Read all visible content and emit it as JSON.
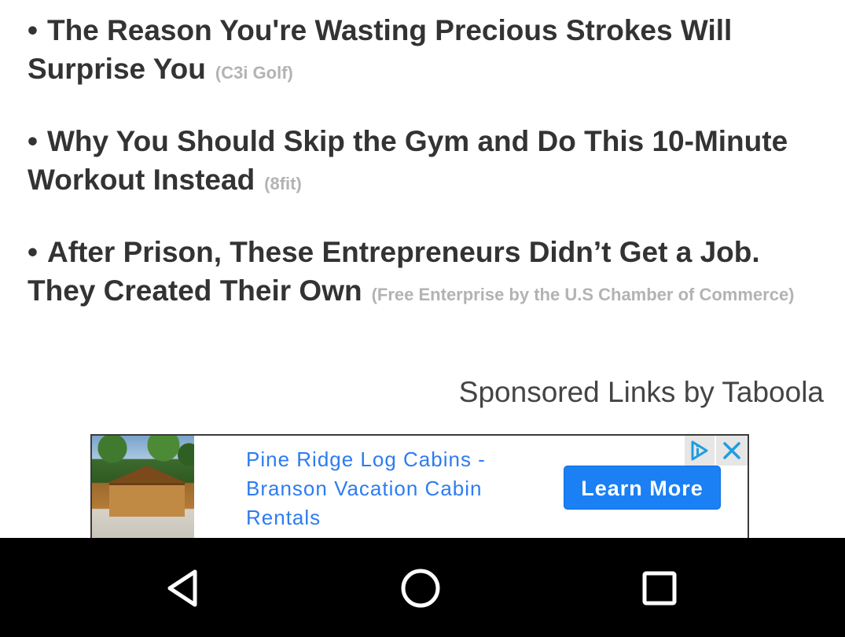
{
  "links": [
    {
      "bullet": "•",
      "title": "The Reason You're Wasting Precious Strokes Will Surprise You",
      "source": "(C3i Golf)"
    },
    {
      "bullet": "•",
      "title": "Why You Should Skip the Gym and Do This 10-Minute Workout Instead",
      "source": "(8fit)"
    },
    {
      "bullet": "•",
      "title": "After Prison, These Entrepreneurs Didn’t Get a Job. They Created Their Own",
      "source": "(Free Enterprise by the U.S Chamber of Commerce)"
    }
  ],
  "sponsored_label": "Sponsored Links by Taboola",
  "ad": {
    "text": "Pine Ridge Log Cabins - Branson Vacation Cabin Rentals",
    "button_label": "Learn More",
    "image_icon": "log-cabin-photo",
    "choices_icon": "adchoices-icon",
    "close_icon": "close-icon"
  },
  "navigation": {
    "back_icon": "back-triangle-icon",
    "home_icon": "home-circle-icon",
    "recents_icon": "recents-square-icon"
  },
  "colors": {
    "headline": "#333333",
    "source": "#b3b3b3",
    "ad_link": "#2d7cf0",
    "ad_button": "#1a80f3",
    "navbar": "#000000"
  }
}
